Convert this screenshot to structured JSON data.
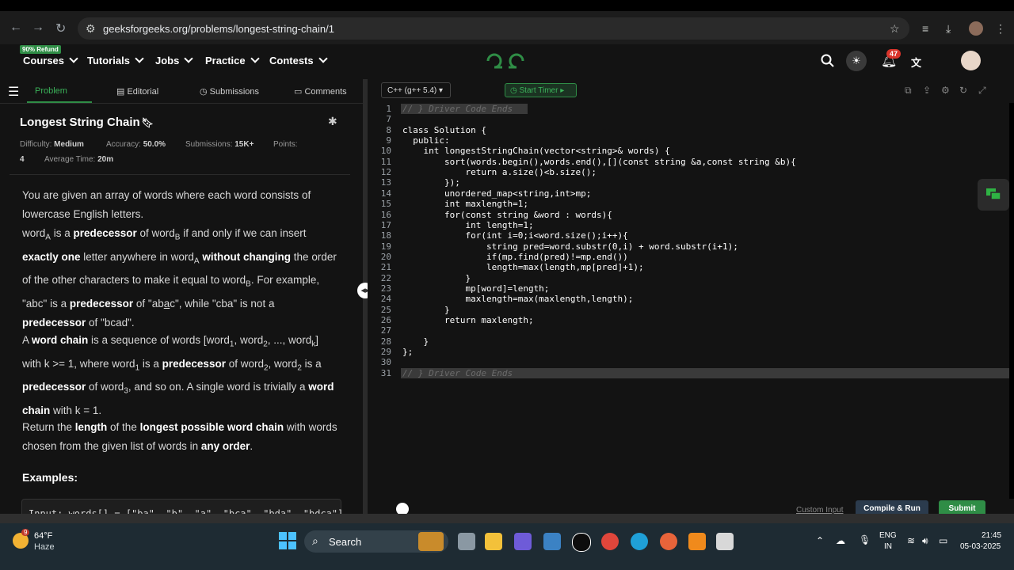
{
  "browser": {
    "url": "geeksforgeeks.org/problems/longest-string-chain/1"
  },
  "header": {
    "refund_badge": "90% Refund",
    "nav": [
      "Courses",
      "Tutorials",
      "Jobs",
      "Practice",
      "Contests"
    ],
    "notification_count": "47"
  },
  "tabs": [
    "Problem",
    "Editorial",
    "Submissions",
    "Comments"
  ],
  "problem": {
    "title": "Longest String Chain",
    "difficulty_label": "Difficulty:",
    "difficulty": "Medium",
    "accuracy_label": "Accuracy:",
    "accuracy": "50.0%",
    "submissions_label": "Submissions:",
    "submissions": "15K+",
    "points_label": "Points:",
    "points": "4",
    "avg_time_label": "Average Time:",
    "avg_time": "20m",
    "examples_title": "Examples:",
    "example_snippet": "Input: words[] = [\"ba\", \"b\", \"a\", \"bca\", \"bda\", \"bdca\"]"
  },
  "editor": {
    "language": "C++ (g++ 5.4)",
    "timer_label": "Start Timer",
    "lines": [
      {
        "n": "1",
        "t": "// } Driver Code Ends",
        "cls": "cm hl"
      },
      {
        "n": "7",
        "t": "",
        "cls": ""
      },
      {
        "n": "8",
        "t": "class Solution {",
        "cls": ""
      },
      {
        "n": "9",
        "t": "  public:",
        "cls": ""
      },
      {
        "n": "10",
        "t": "    int longestStringChain(vector<string>& words) {",
        "cls": ""
      },
      {
        "n": "11",
        "t": "        sort(words.begin(),words.end(),[](const string &a,const string &b){",
        "cls": ""
      },
      {
        "n": "12",
        "t": "            return a.size()<b.size();",
        "cls": ""
      },
      {
        "n": "13",
        "t": "        });",
        "cls": ""
      },
      {
        "n": "14",
        "t": "        unordered_map<string,int>mp;",
        "cls": ""
      },
      {
        "n": "15",
        "t": "        int maxlength=1;",
        "cls": ""
      },
      {
        "n": "16",
        "t": "        for(const string &word : words){",
        "cls": ""
      },
      {
        "n": "17",
        "t": "            int length=1;",
        "cls": ""
      },
      {
        "n": "18",
        "t": "            for(int i=0;i<word.size();i++){",
        "cls": ""
      },
      {
        "n": "19",
        "t": "                string pred=word.substr(0,i) + word.substr(i+1);",
        "cls": ""
      },
      {
        "n": "20",
        "t": "                if(mp.find(pred)!=mp.end())",
        "cls": ""
      },
      {
        "n": "21",
        "t": "                length=max(length,mp[pred]+1);",
        "cls": ""
      },
      {
        "n": "22",
        "t": "            }",
        "cls": ""
      },
      {
        "n": "23",
        "t": "            mp[word]=length;",
        "cls": ""
      },
      {
        "n": "24",
        "t": "            maxlength=max(maxlength,length);",
        "cls": ""
      },
      {
        "n": "25",
        "t": "        }",
        "cls": ""
      },
      {
        "n": "26",
        "t": "        return maxlength;",
        "cls": ""
      },
      {
        "n": "27",
        "t": "",
        "cls": ""
      },
      {
        "n": "28",
        "t": "    }",
        "cls": ""
      },
      {
        "n": "29",
        "t": "};",
        "cls": ""
      },
      {
        "n": "30",
        "t": "",
        "cls": ""
      },
      {
        "n": "31",
        "t": "// } Driver Code Ends",
        "cls": "cm hl"
      }
    ],
    "custom_input": "Custom Input",
    "compile_run": "Compile & Run",
    "submit": "Submit"
  },
  "taskbar": {
    "temp": "64°F",
    "weather": "Haze",
    "weather_badge": "9",
    "search": "Search",
    "lang_top": "ENG",
    "lang_bottom": "IN",
    "time": "21:45",
    "date": "05-03-2025"
  }
}
